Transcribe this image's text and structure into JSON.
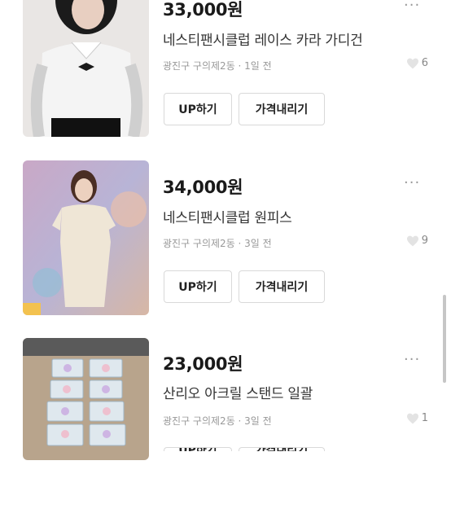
{
  "listings": [
    {
      "price": "33,000원",
      "title": "네스티팬시클럽 레이스 카라 가디건",
      "meta": "광진구 구의제2동 · 1일 전",
      "likes": "6",
      "more_icon": "···",
      "up_label": "UP하기",
      "price_label": "가격내리기"
    },
    {
      "price": "34,000원",
      "title": "네스티팬시클럽 원피스",
      "meta": "광진구 구의제2동 · 3일 전",
      "likes": "9",
      "more_icon": "···",
      "up_label": "UP하기",
      "price_label": "가격내리기"
    },
    {
      "price": "23,000원",
      "title": "산리오 아크릴 스탠드 일괄",
      "meta": "광진구 구의제2동 · 3일 전",
      "likes": "1",
      "more_icon": "···",
      "up_label": "UP하기",
      "price_label": "가격내리기"
    }
  ],
  "colors": {
    "price": "#1a1a1a",
    "meta": "#999999",
    "button_border": "#d9d9d9"
  }
}
